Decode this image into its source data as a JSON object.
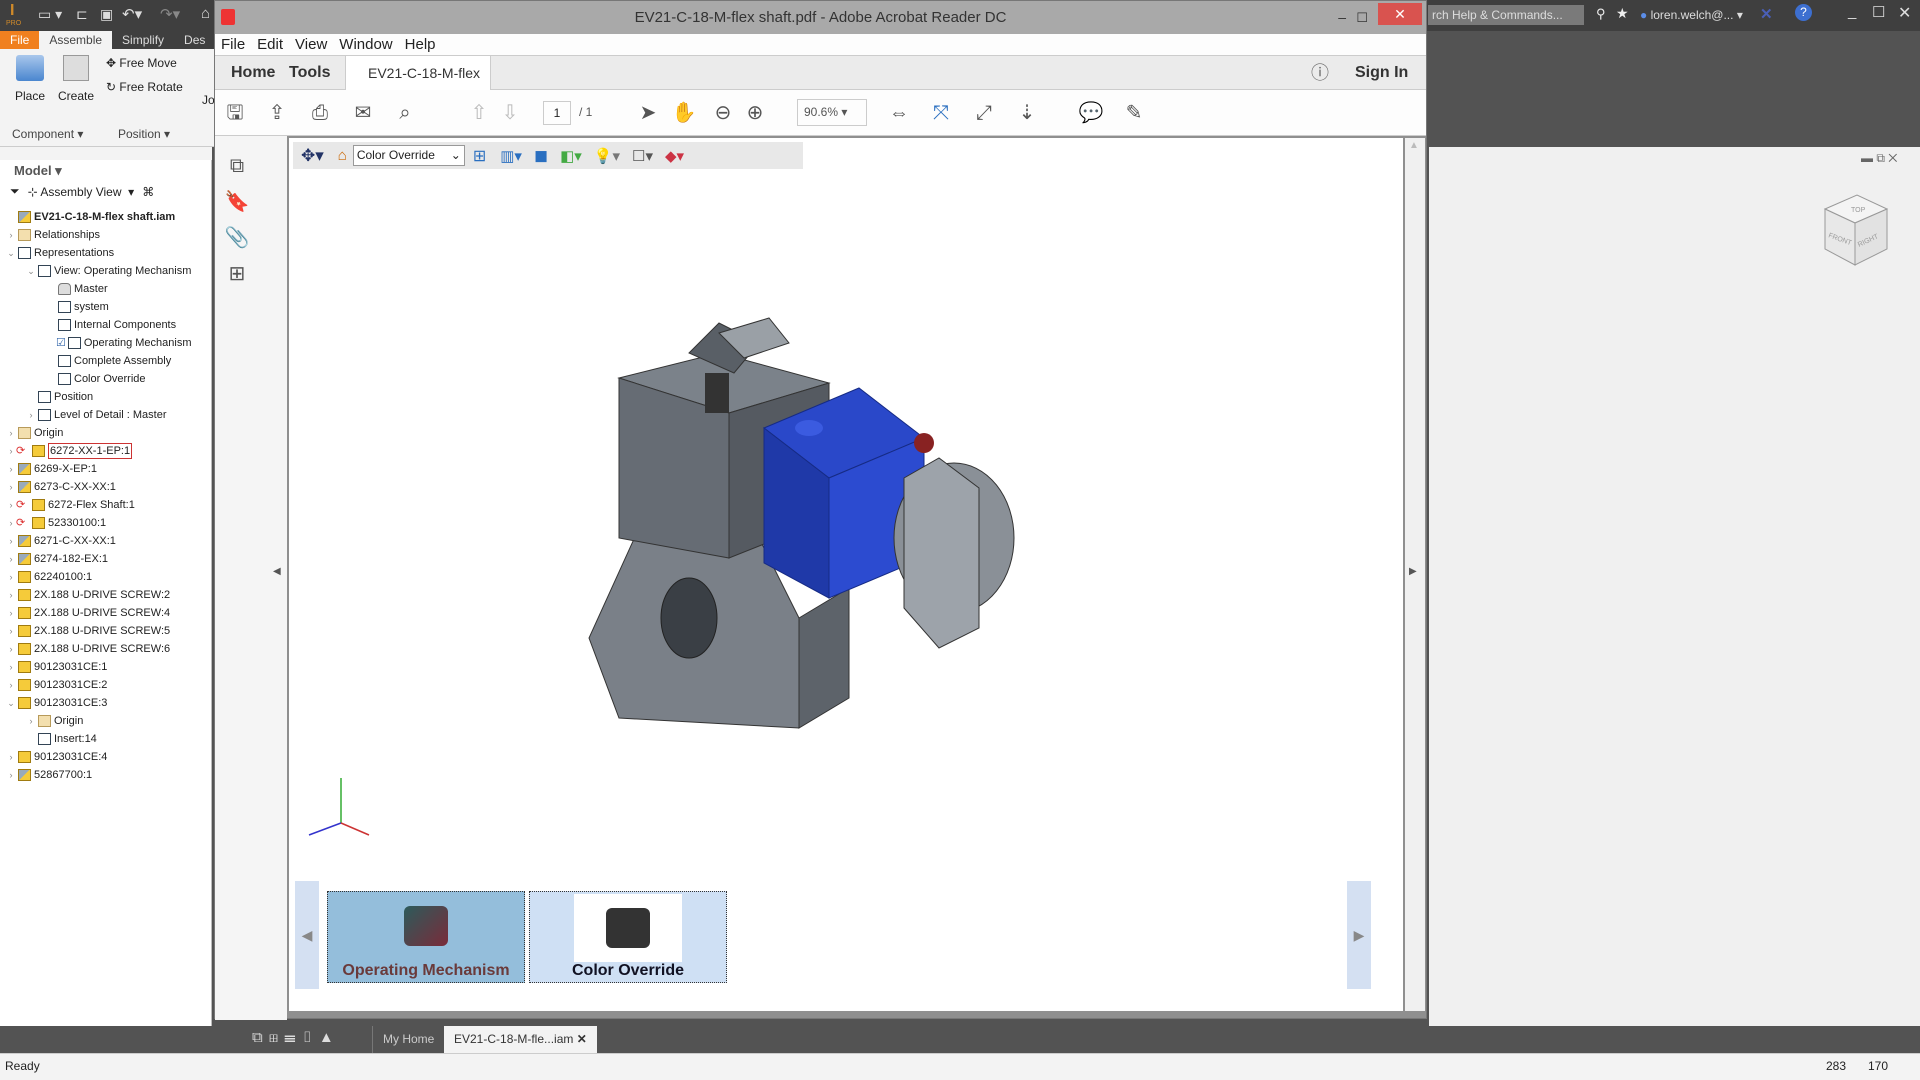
{
  "inventor": {
    "badge": "PRO",
    "tabs": [
      "File",
      "Assemble",
      "Simplify",
      "Des"
    ],
    "ribbon": {
      "place": "Place",
      "create": "Create",
      "free_move": "Free Move",
      "free_rotate": "Free Rotate",
      "jo": "Jo",
      "component": "Component",
      "position": "Position"
    },
    "search_placeholder": "rch Help & Commands...",
    "user": "loren.welch@...",
    "browser": {
      "model": "Model",
      "view": "Assembly View",
      "items": [
        {
          "label": "EV21-C-18-M-flex shaft.iam",
          "level": 0,
          "icon": "sub",
          "tw": ""
        },
        {
          "label": "Relationships",
          "level": 0,
          "icon": "folder",
          "tw": "›"
        },
        {
          "label": "Representations",
          "level": 0,
          "icon": "rep",
          "tw": "⌄"
        },
        {
          "label": "View: Operating Mechanism",
          "level": 1,
          "icon": "rep",
          "tw": "⌄"
        },
        {
          "label": "Master",
          "level": 2,
          "icon": "lock",
          "tw": ""
        },
        {
          "label": "system",
          "level": 2,
          "icon": "rep",
          "tw": ""
        },
        {
          "label": "Internal Components",
          "level": 2,
          "icon": "rep",
          "tw": ""
        },
        {
          "label": "Operating Mechanism",
          "level": 2,
          "icon": "rep",
          "tw": "",
          "checked": true
        },
        {
          "label": "Complete Assembly",
          "level": 2,
          "icon": "rep",
          "tw": ""
        },
        {
          "label": "Color Override",
          "level": 2,
          "icon": "rep",
          "tw": ""
        },
        {
          "label": "Position",
          "level": 1,
          "icon": "rep",
          "tw": ""
        },
        {
          "label": "Level of Detail : Master",
          "level": 1,
          "icon": "rep",
          "tw": "›"
        },
        {
          "label": "Origin",
          "level": 0,
          "icon": "folder",
          "tw": "›"
        },
        {
          "label": "6272-XX-1-EP:1",
          "level": 0,
          "icon": "part",
          "tw": "›",
          "sync": true,
          "selected": true
        },
        {
          "label": "6269-X-EP:1",
          "level": 0,
          "icon": "sub",
          "tw": "›"
        },
        {
          "label": "6273-C-XX-XX:1",
          "level": 0,
          "icon": "sub",
          "tw": "›"
        },
        {
          "label": "6272-Flex Shaft:1",
          "level": 0,
          "icon": "part",
          "tw": "›",
          "sync": true
        },
        {
          "label": "52330100:1",
          "level": 0,
          "icon": "part",
          "tw": "›",
          "sync": true
        },
        {
          "label": "6271-C-XX-XX:1",
          "level": 0,
          "icon": "sub",
          "tw": "›"
        },
        {
          "label": "6274-182-EX:1",
          "level": 0,
          "icon": "sub",
          "tw": "›"
        },
        {
          "label": "62240100:1",
          "level": 0,
          "icon": "part",
          "tw": "›"
        },
        {
          "label": "2X.188 U-DRIVE SCREW:2",
          "level": 0,
          "icon": "part",
          "tw": "›"
        },
        {
          "label": "2X.188 U-DRIVE SCREW:4",
          "level": 0,
          "icon": "part",
          "tw": "›"
        },
        {
          "label": "2X.188 U-DRIVE SCREW:5",
          "level": 0,
          "icon": "part",
          "tw": "›"
        },
        {
          "label": "2X.188 U-DRIVE SCREW:6",
          "level": 0,
          "icon": "part",
          "tw": "›"
        },
        {
          "label": "90123031CE:1",
          "level": 0,
          "icon": "part",
          "tw": "›"
        },
        {
          "label": "90123031CE:2",
          "level": 0,
          "icon": "part",
          "tw": "›"
        },
        {
          "label": "90123031CE:3",
          "level": 0,
          "icon": "part",
          "tw": "⌄"
        },
        {
          "label": "Origin",
          "level": 1,
          "icon": "folder",
          "tw": "›"
        },
        {
          "label": "Insert:14",
          "level": 1,
          "icon": "rep",
          "tw": ""
        },
        {
          "label": "90123031CE:4",
          "level": 0,
          "icon": "part",
          "tw": "›"
        },
        {
          "label": "52867700:1",
          "level": 0,
          "icon": "sub",
          "tw": "›"
        }
      ]
    },
    "viewcube": {
      "top": "TOP",
      "front": "FRONT",
      "right": "RIGHT"
    },
    "doc_tabs": {
      "home": "My Home",
      "file": "EV21-C-18-M-fle...iam"
    },
    "status": {
      "text": "Ready",
      "x": "283",
      "y": "170"
    }
  },
  "acrobat": {
    "title": "EV21-C-18-M-flex shaft.pdf - Adobe Acrobat Reader DC",
    "menu": [
      "File",
      "Edit",
      "View",
      "Window",
      "Help"
    ],
    "tabs": {
      "home": "Home",
      "tools": "Tools",
      "doc": "EV21-C-18-M-flex ..."
    },
    "sign_in": "Sign In",
    "page": {
      "current": "1",
      "total": "/ 1"
    },
    "zoom": "90.6%",
    "view_select": "Color Override",
    "thumbnails": [
      {
        "label": "Operating Mechanism",
        "selected": true
      },
      {
        "label": "Color Override",
        "selected": false
      }
    ]
  },
  "colors": {
    "accent": "#f0801f",
    "blue_part": "#1f3fbf",
    "close": "#d9534f"
  }
}
